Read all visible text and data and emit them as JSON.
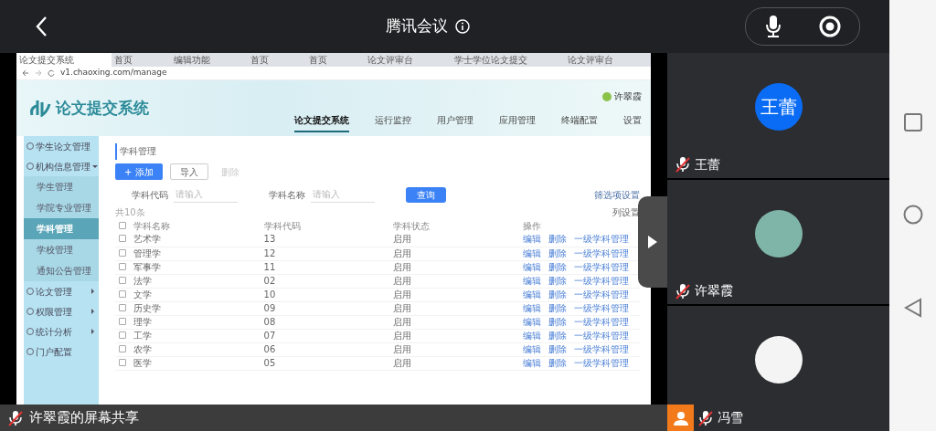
{
  "app_bar": {
    "title": "腾讯会议"
  },
  "shared_screen": {
    "browser": {
      "tabs": [
        {
          "title": "论文提交系统",
          "selected": true
        },
        {
          "title": "首页",
          "selected": false
        },
        {
          "title": "编辑功能",
          "selected": false
        },
        {
          "title": "首页",
          "selected": false
        },
        {
          "title": "首页",
          "selected": false
        },
        {
          "title": "论文评审台",
          "selected": false
        },
        {
          "title": "学士学位论文提交",
          "selected": false
        },
        {
          "title": "论文评审台",
          "selected": false
        }
      ],
      "address": "v1.chaoxing.com/manage"
    },
    "site": {
      "logo_text": "论文提交系统",
      "user": "许翠霞",
      "nav": [
        {
          "label": "论文提交系统",
          "selected": true
        },
        {
          "label": "运行监控",
          "selected": false
        },
        {
          "label": "用户管理",
          "selected": false
        },
        {
          "label": "应用管理",
          "selected": false
        },
        {
          "label": "终端配置",
          "selected": false
        },
        {
          "label": "设置",
          "selected": false
        }
      ]
    },
    "sidebar": [
      {
        "label": "学生论文管理"
      },
      {
        "label": "机构信息管理",
        "expanded": true,
        "children": [
          {
            "label": "学生管理",
            "selected": false
          },
          {
            "label": "学院专业管理",
            "selected": false
          },
          {
            "label": "学科管理",
            "selected": true
          },
          {
            "label": "学校管理",
            "selected": false
          },
          {
            "label": "通知公告管理",
            "selected": false
          }
        ]
      },
      {
        "label": "论文管理",
        "expanded": false
      },
      {
        "label": "权限管理",
        "expanded": false
      },
      {
        "label": "统计分析",
        "expanded": false
      },
      {
        "label": "门户配置"
      }
    ],
    "breadcrumb": "学科管理",
    "buttons": [
      {
        "label": "+ 添加",
        "kind": "primary"
      },
      {
        "label": "导入",
        "kind": "outline"
      },
      {
        "label": "删除",
        "kind": "disabled"
      }
    ],
    "search_fields": [
      {
        "label": "学科代码",
        "placeholder": "请输入"
      },
      {
        "label": "学科名称",
        "placeholder": "请输入"
      }
    ],
    "search_button": "查询",
    "filter_settings": "筛选项设置",
    "count": "共10条",
    "column_settings": "列设置",
    "table": {
      "select_all_checked": false,
      "columns": [
        "学科名称",
        "学科代码",
        "学科状态",
        "操作"
      ],
      "rows": [
        {
          "name": "艺术学",
          "code": "13",
          "status": "启用",
          "checked": false,
          "actions": [
            "编辑",
            "删除",
            "一级学科管理"
          ]
        },
        {
          "name": "管理学",
          "code": "12",
          "status": "启用",
          "checked": false,
          "actions": [
            "编辑",
            "删除",
            "一级学科管理"
          ]
        },
        {
          "name": "军事学",
          "code": "11",
          "status": "启用",
          "checked": false,
          "actions": [
            "编辑",
            "删除",
            "一级学科管理"
          ]
        },
        {
          "name": "法学",
          "code": "02",
          "status": "启用",
          "checked": false,
          "actions": [
            "编辑",
            "删除",
            "一级学科管理"
          ]
        },
        {
          "name": "文学",
          "code": "10",
          "status": "启用",
          "checked": false,
          "actions": [
            "编辑",
            "删除",
            "一级学科管理"
          ]
        },
        {
          "name": "历史学",
          "code": "09",
          "status": "启用",
          "checked": false,
          "actions": [
            "编辑",
            "删除",
            "一级学科管理"
          ]
        },
        {
          "name": "理学",
          "code": "08",
          "status": "启用",
          "checked": false,
          "actions": [
            "编辑",
            "删除",
            "一级学科管理"
          ]
        },
        {
          "name": "工学",
          "code": "07",
          "status": "启用",
          "checked": false,
          "actions": [
            "编辑",
            "删除",
            "一级学科管理"
          ]
        },
        {
          "name": "农学",
          "code": "06",
          "status": "启用",
          "checked": false,
          "actions": [
            "编辑",
            "删除",
            "一级学科管理"
          ]
        },
        {
          "name": "医学",
          "code": "05",
          "status": "启用",
          "checked": false,
          "actions": [
            "编辑",
            "删除",
            "一级学科管理"
          ]
        }
      ]
    }
  },
  "share_label": {
    "text": "许翠霞的屏幕共享",
    "muted": true
  },
  "participants": [
    {
      "name": "王蕾",
      "muted": true,
      "avatar": {
        "kind": "initials",
        "text": "王蕾"
      },
      "highlighted": false
    },
    {
      "name": "许翠霞",
      "muted": true,
      "avatar": {
        "kind": "illustration"
      },
      "highlighted": false
    },
    {
      "name": "冯雪",
      "muted": true,
      "avatar": {
        "kind": "portrait"
      },
      "highlighted": true
    }
  ]
}
